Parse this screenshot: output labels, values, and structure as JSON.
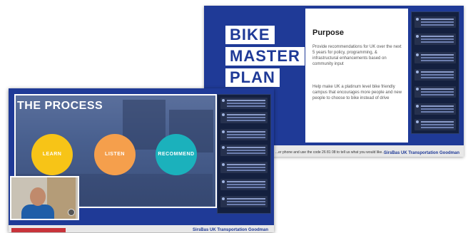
{
  "back_slide": {
    "title_words": [
      "BIKE",
      "MASTER",
      "PLAN"
    ],
    "heading": "Purpose",
    "paragraph1": "Provide recommendations for UK over the next 5 years for policy, programming, & infrastructural enhancements based on community input",
    "paragraph2": "Help make UK a platinum level bike friendly campus that encourages more people and new people to choose to bike instead of drive",
    "ticker": "...er phone and use the code 26 81 08 to tell us what you would like...",
    "logos": "SirsBas  UK  Transportation  Goodman"
  },
  "front_slide": {
    "title": "THE PROCESS",
    "steps": [
      {
        "label": "LEARN",
        "color": "#f7c417"
      },
      {
        "label": "LISTEN",
        "color": "#f59f4c"
      },
      {
        "label": "RECOMMEND",
        "color": "#1bb1bc"
      }
    ],
    "logos": "SirsBas  UK  Transportation  Goodman"
  },
  "colors": {
    "brand_blue": "#1f3a97",
    "chat_panel": "#14203f",
    "accent_orange": "#f29b2a"
  }
}
